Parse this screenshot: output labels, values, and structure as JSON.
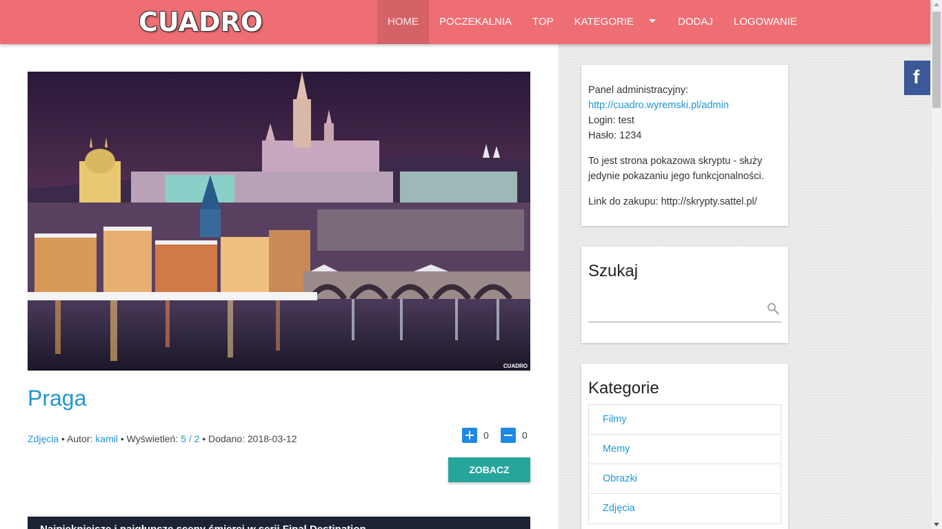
{
  "header": {
    "logo": "CUADRO",
    "nav": [
      {
        "label": "HOME",
        "active": true
      },
      {
        "label": "POCZEKALNIA"
      },
      {
        "label": "TOP"
      },
      {
        "label": "KATEGORIE"
      },
      {
        "label": "DODAJ"
      },
      {
        "label": "LOGOWANIE"
      }
    ]
  },
  "post": {
    "watermark": "CUADRO",
    "title": "Praga",
    "category": "Zdjęcia",
    "author_prefix": "• Autor:",
    "author": "kamil",
    "views_prefix": "• Wyświetleń:",
    "views": "5 / 2",
    "added_prefix": "• Dodano:",
    "added": "2018-03-12",
    "upvotes": "0",
    "downvotes": "0",
    "button": "ZOBACZ"
  },
  "next_post": {
    "title": "Najpiękniejsze i najgłupsze sceny śmierci w serii Final Destination"
  },
  "sidebar": {
    "info": {
      "panel_label": "Panel administracyjny:",
      "panel_link": "http://cuadro.wyremski.pl/admin",
      "login": "Login: test",
      "password": "Hasło: 1234",
      "note": "To jest strona pokazowa skryptu - służy jedynie pokazaniu jego funkcjonalności.",
      "buy": "Link do zakupu: http://skrypty.sattel.pl/"
    },
    "search": {
      "title": "Szukaj",
      "placeholder": ""
    },
    "categories": {
      "title": "Kategorie",
      "items": [
        "Filmy",
        "Memy",
        "Obrazki",
        "Zdjęcia"
      ]
    },
    "facebook_label": "f"
  },
  "colors": {
    "header": "#ee6e73",
    "link": "#2196d3",
    "button": "#26a69a",
    "vote": "#1e88e5",
    "facebook": "#3b5998"
  }
}
